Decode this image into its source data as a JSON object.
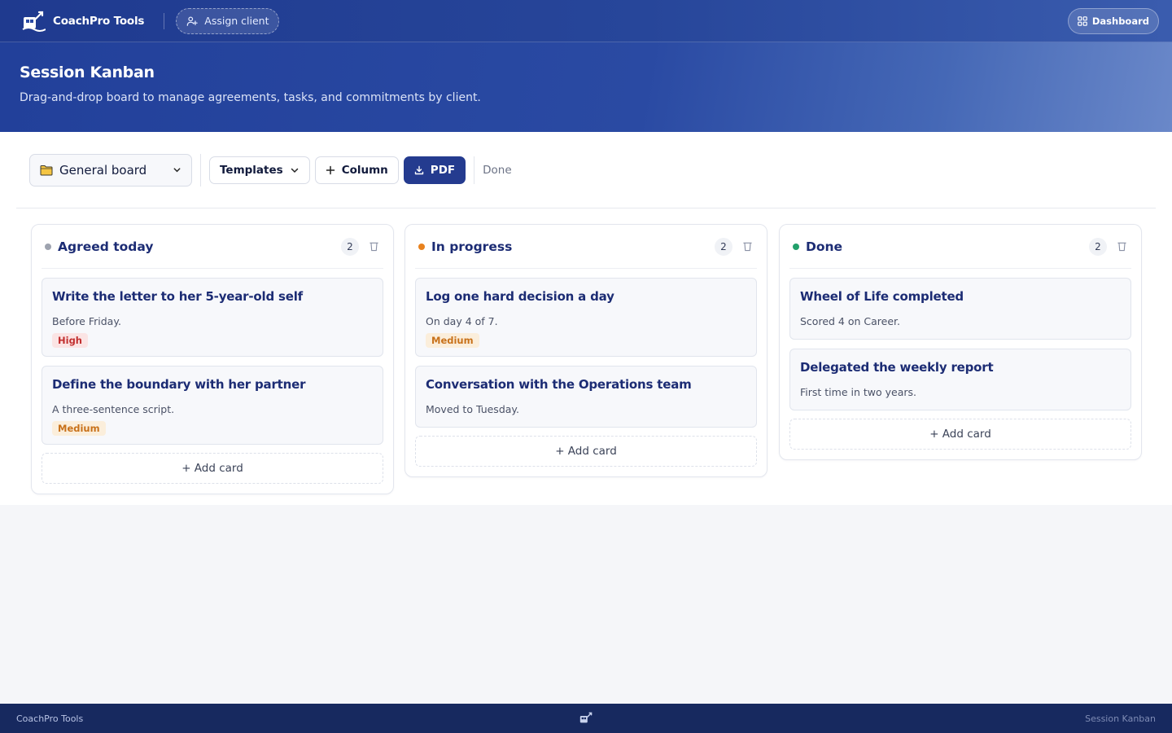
{
  "app": {
    "name": "CoachPro Tools",
    "assign_label": "Assign client",
    "dashboard_label": "Dashboard"
  },
  "hero": {
    "title": "Session Kanban",
    "subtitle": "Drag-and-drop board to manage agreements, tasks, and commitments by client."
  },
  "toolbar": {
    "board_select": "General board",
    "templates_label": "Templates",
    "column_label": "Column",
    "pdf_label": "PDF",
    "status": "Done"
  },
  "columns": [
    {
      "title": "Agreed today",
      "dot_color": "#9ea3af",
      "count": "2",
      "cards": [
        {
          "title": "Write the letter to her 5-year-old self",
          "desc": "Before Friday.",
          "tag": "High"
        },
        {
          "title": "Define the boundary with her partner",
          "desc": "A three-sentence script.",
          "tag": "Medium"
        }
      ],
      "add_label": "+ Add card"
    },
    {
      "title": "In progress",
      "dot_color": "#e8821e",
      "count": "2",
      "cards": [
        {
          "title": "Log one hard decision a day",
          "desc": "On day 4 of 7.",
          "tag": "Medium"
        },
        {
          "title": "Conversation with the Operations team",
          "desc": "Moved to Tuesday.",
          "tag": ""
        }
      ],
      "add_label": "+ Add card"
    },
    {
      "title": "Done",
      "dot_color": "#22a06b",
      "count": "2",
      "cards": [
        {
          "title": "Wheel of Life completed",
          "desc": "Scored 4 on Career.",
          "tag": ""
        },
        {
          "title": "Delegated the weekly report",
          "desc": "First time in two years.",
          "tag": ""
        }
      ],
      "add_label": "+ Add card"
    }
  ],
  "footer": {
    "left": "CoachPro Tools",
    "right": "Session Kanban"
  },
  "icons": {
    "logo": "coachpro-logo-icon",
    "assign": "user-plus-icon",
    "dashboard": "grid-icon",
    "folder": "folder-icon",
    "chevron": "chevron-down-icon",
    "plus": "plus-icon",
    "download": "download-icon",
    "trash": "trash-icon"
  },
  "colors": {
    "brand": "#243b8f",
    "high_tag_bg": "#fbe4e4",
    "high_tag_text": "#c22f2f",
    "medium_tag_bg": "#fbeedb",
    "medium_tag_text": "#c8711a"
  }
}
